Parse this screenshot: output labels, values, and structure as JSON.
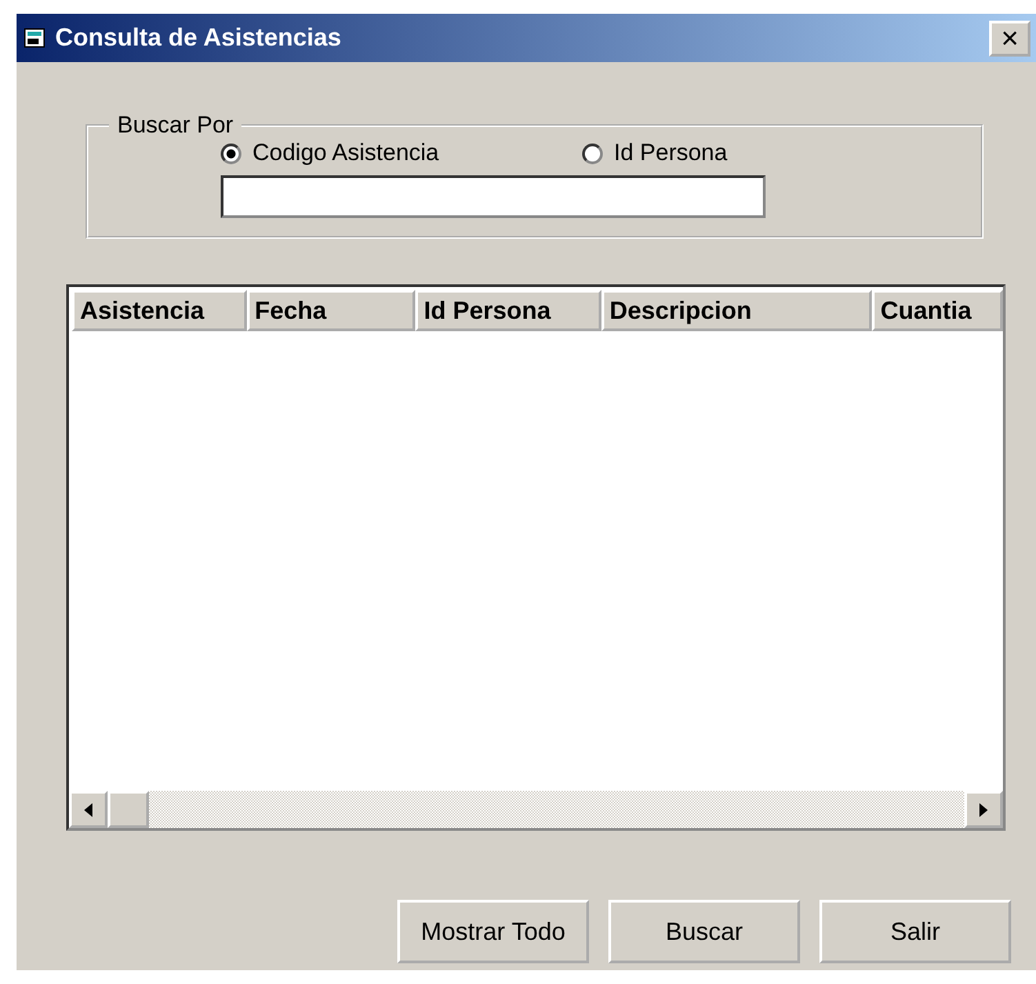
{
  "window": {
    "title": "Consulta de Asistencias",
    "close": "×"
  },
  "search_group": {
    "legend": "Buscar Por",
    "options": [
      {
        "label": "Codigo Asistencia",
        "selected": true
      },
      {
        "label": "Id Persona",
        "selected": false
      }
    ]
  },
  "table": {
    "columns": [
      "Asistencia",
      "Fecha",
      "Id Persona",
      "Descripcion",
      "Cuantia"
    ]
  },
  "buttons": [
    "Mostrar Todo",
    "Buscar",
    "Salir"
  ]
}
